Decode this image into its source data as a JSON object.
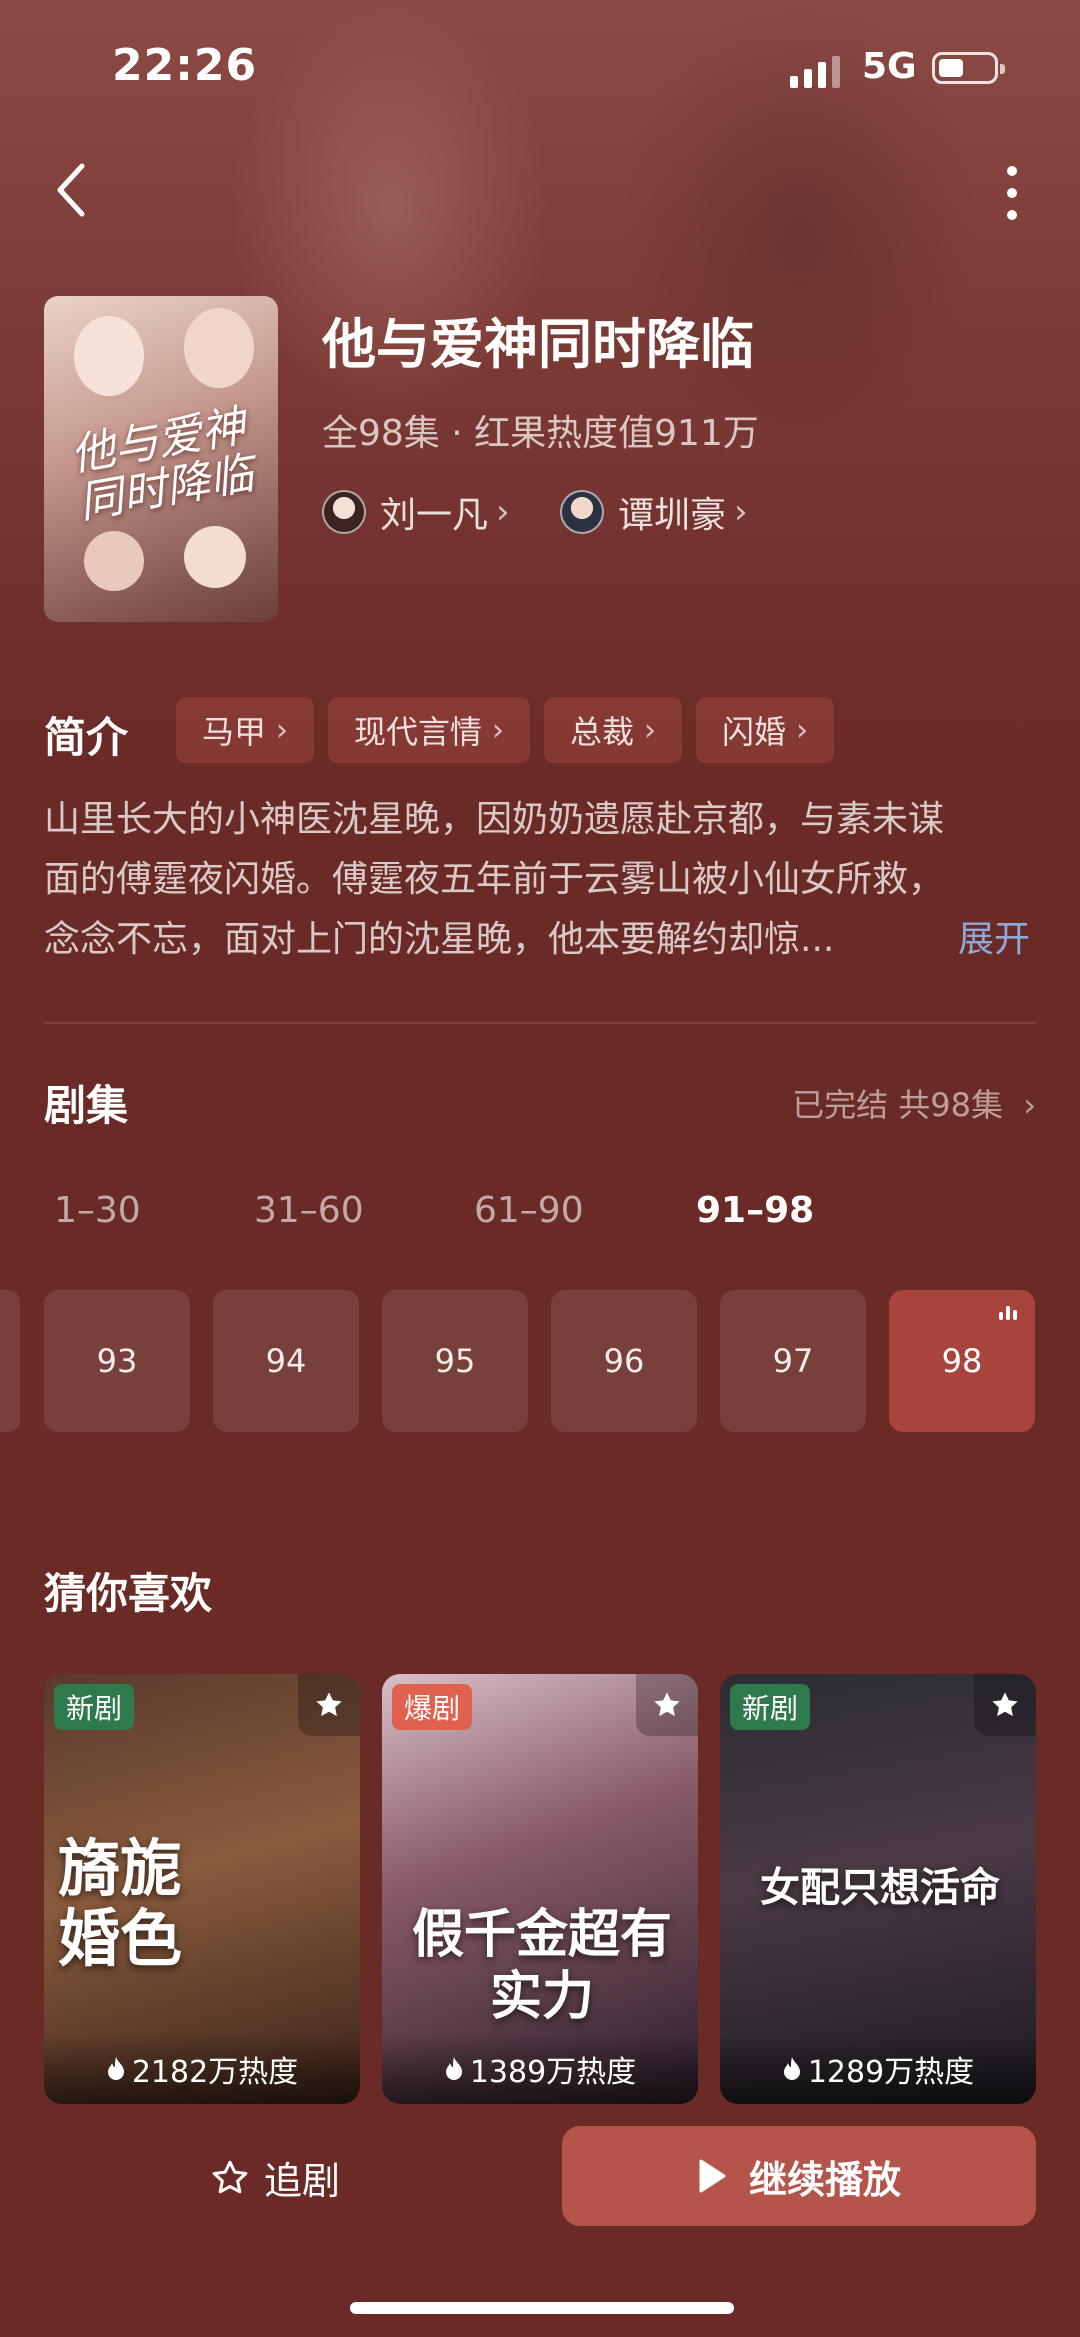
{
  "status_bar": {
    "time": "22:26",
    "network": "5G"
  },
  "drama": {
    "title": "他与爱神同时降临",
    "poster_title": "他与爱神同时降临",
    "meta": "全98集 · 红果热度值911万",
    "actors": [
      {
        "name": "刘一凡"
      },
      {
        "name": "谭圳豪"
      }
    ]
  },
  "intro": {
    "heading": "简介",
    "tags": [
      "马甲",
      "现代言情",
      "总裁",
      "闪婚"
    ],
    "description": "山里长大的小神医沈星晚，因奶奶遗愿赴京都，与素未谋面的傅霆夜闪婚。傅霆夜五年前于云雾山被小仙女所救，念念不忘，面对上门的沈星晚，他本要解约却惊...",
    "expand_label": "展开"
  },
  "episodes": {
    "heading": "剧集",
    "status": "已完结 共98集",
    "ranges": [
      "1–30",
      "31–60",
      "61–90",
      "91–98"
    ],
    "active_range": "91–98",
    "items": [
      "93",
      "94",
      "95",
      "96",
      "97",
      "98"
    ],
    "current": "98"
  },
  "recommend": {
    "heading": "猜你喜欢",
    "items": [
      {
        "badge": "新剧",
        "title": "旖旎婚色",
        "heat": "2182万热度",
        "badge_color": "#2f7a4c"
      },
      {
        "badge": "爆剧",
        "title": "假千金超有实力",
        "heat": "1389万热度",
        "badge_color": "#e0614f"
      },
      {
        "badge": "新剧",
        "title": "女配只想活命",
        "heat": "1289万热度",
        "badge_color": "#2f7a4c"
      }
    ]
  },
  "bottom_bar": {
    "follow_label": "追剧",
    "play_label": "继续播放"
  },
  "colors": {
    "background": "#6a2a26",
    "accent": "#b4544a",
    "current_episode": "#a8443b",
    "link": "#8fa8d8"
  },
  "icons": {
    "back": "chevron-left-icon",
    "more": "more-vertical-icon",
    "star": "star-icon",
    "flame": "flame-icon",
    "play": "play-icon"
  }
}
